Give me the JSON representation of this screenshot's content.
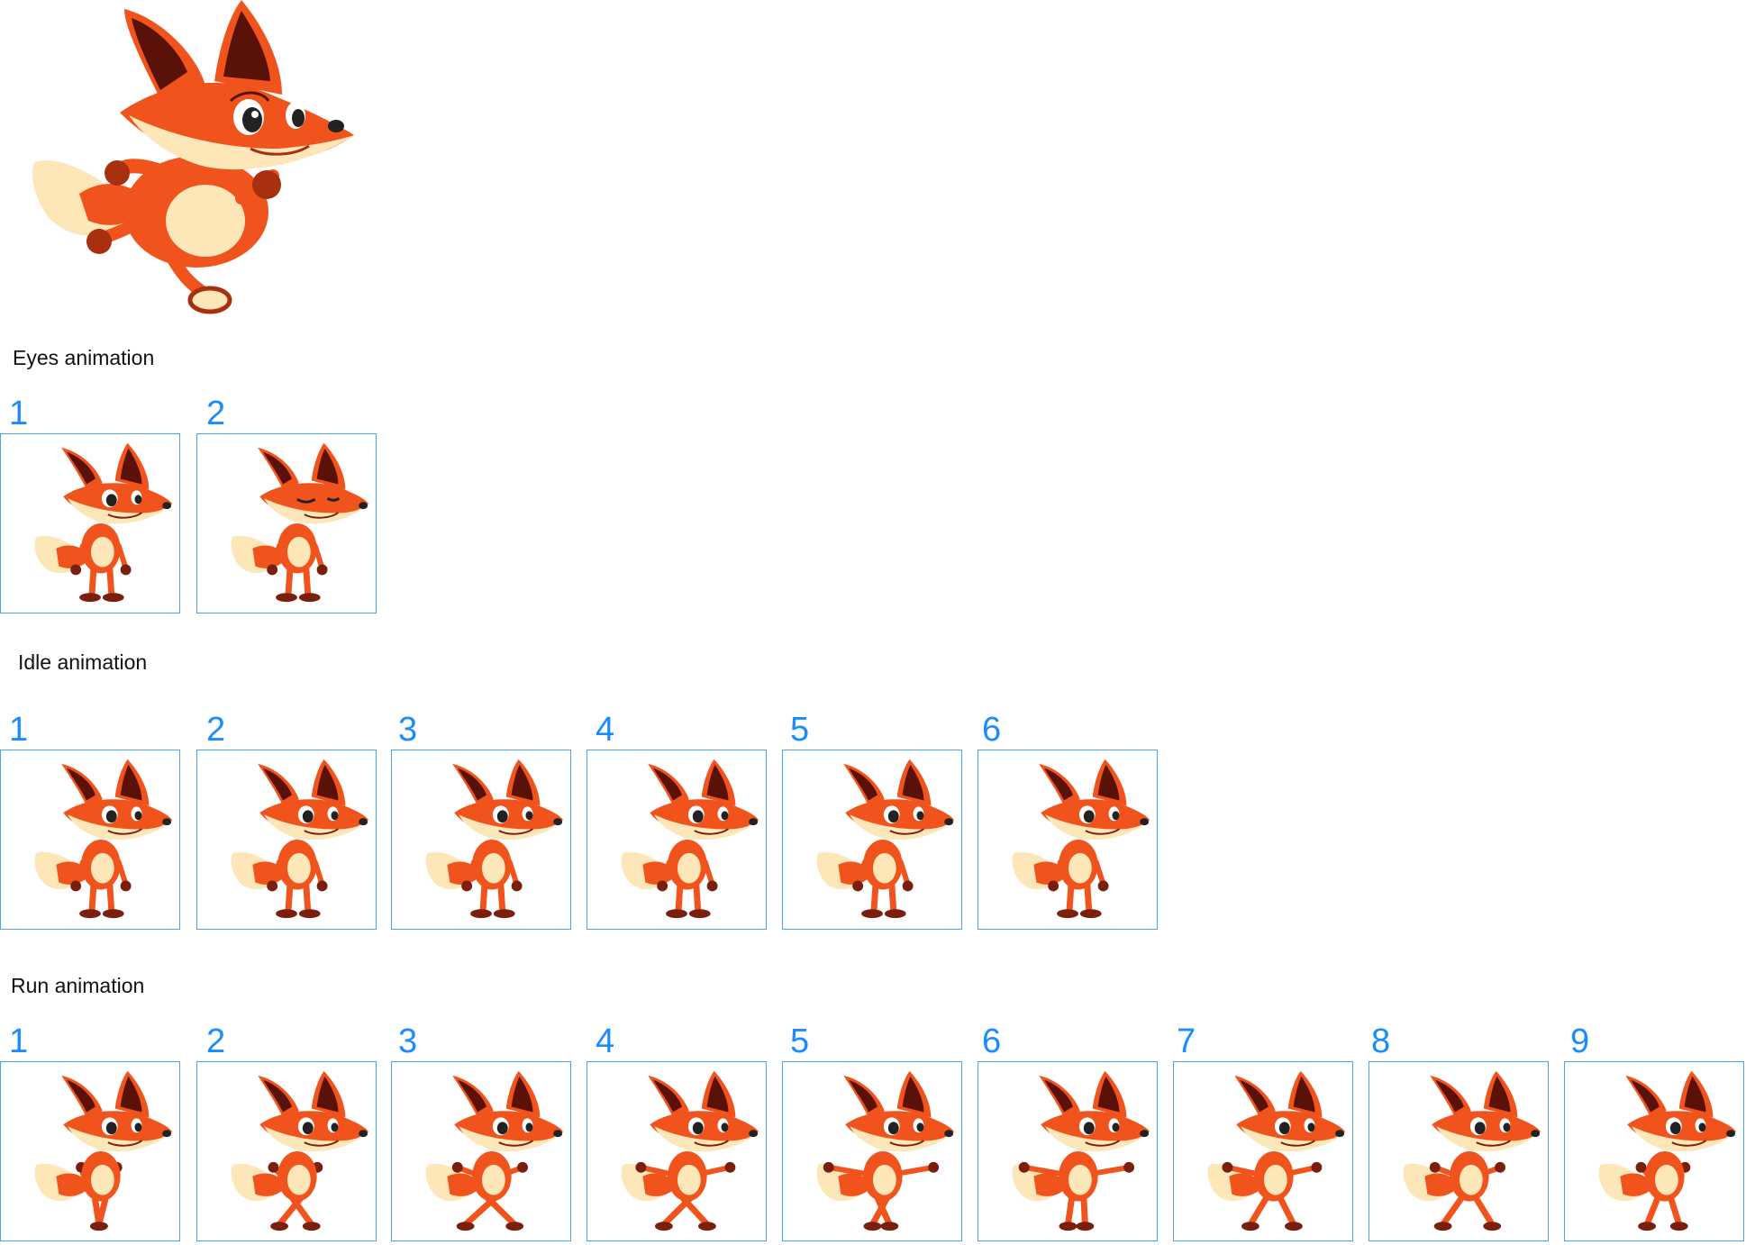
{
  "hero": {
    "icon": "fox-character-running"
  },
  "sections": [
    {
      "title": "Eyes animation",
      "frames": [
        "1",
        "2"
      ],
      "variants": [
        "eyes-open",
        "eyes-closed"
      ]
    },
    {
      "title": "Idle animation",
      "frames": [
        "1",
        "2",
        "3",
        "4",
        "5",
        "6"
      ],
      "variants": [
        "idle",
        "idle",
        "idle",
        "idle",
        "idle",
        "idle"
      ]
    },
    {
      "title": "Run animation",
      "frames": [
        "1",
        "2",
        "3",
        "4",
        "5",
        "6",
        "7",
        "8",
        "9"
      ],
      "variants": [
        "run",
        "run",
        "run",
        "run",
        "run",
        "run",
        "run",
        "run",
        "run"
      ]
    }
  ],
  "colors": {
    "frame_border": "#4aa3ee",
    "frame_number": "#1a8cff",
    "fox_orange": "#f0531b",
    "fox_dark": "#7a1f0e",
    "fox_cream": "#fde6b8"
  }
}
